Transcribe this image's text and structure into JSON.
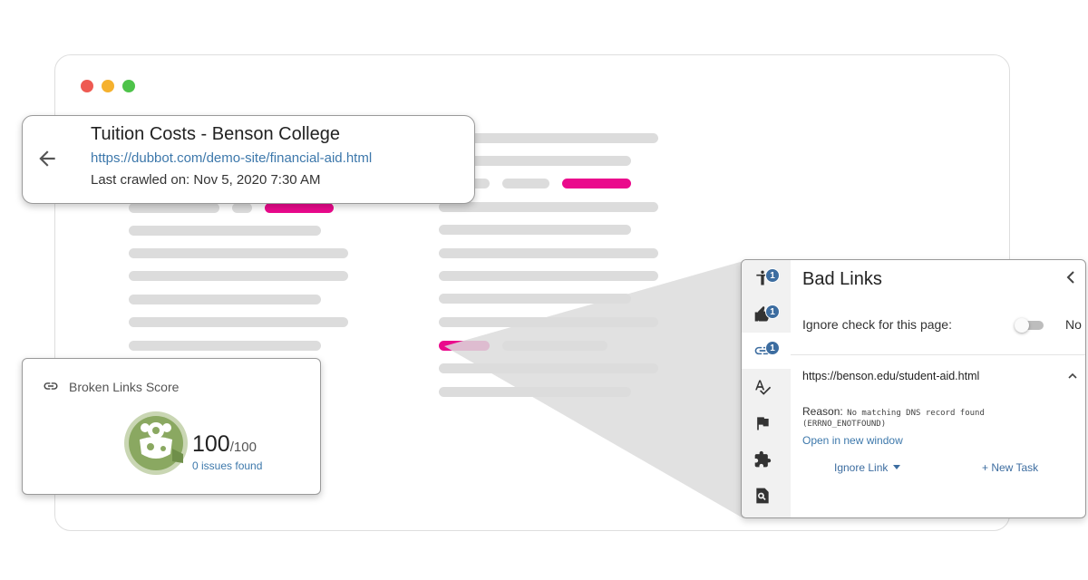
{
  "page": {
    "title": "Tuition Costs - Benson College",
    "url": "https://dubbot.com/demo-site/financial-aid.html",
    "last_crawled": "Last crawled on: Nov 5, 2020 7:30 AM"
  },
  "score": {
    "title": "Broken Links Score",
    "value": "100",
    "max": "/100",
    "issues": "0 issues found"
  },
  "panel": {
    "title": "Bad Links",
    "ignore_label": "Ignore check for this page:",
    "toggle_state": "No",
    "link_url": "https://benson.edu/student-aid.html",
    "reason_label": "Reason:",
    "reason_text": "No matching DNS record found",
    "reason_code": "(ERRNO_ENOTFOUND)",
    "open_link": "Open in new window",
    "ignore_button": "Ignore Link",
    "new_task_button": "+ New Task",
    "rail": [
      {
        "icon": "accessibility-icon",
        "badge": "1"
      },
      {
        "icon": "best-practices-icon",
        "badge": "1"
      },
      {
        "icon": "link-icon",
        "badge": "1"
      },
      {
        "icon": "spelling-icon",
        "badge": ""
      },
      {
        "icon": "flag-icon",
        "badge": ""
      },
      {
        "icon": "puzzle-icon",
        "badge": ""
      },
      {
        "icon": "page-search-icon",
        "badge": ""
      }
    ]
  },
  "colors": {
    "accent": "#3d78ab",
    "highlight": "#ea0a8c",
    "badge": "#3d6da0",
    "score_green": "#8aa861"
  }
}
